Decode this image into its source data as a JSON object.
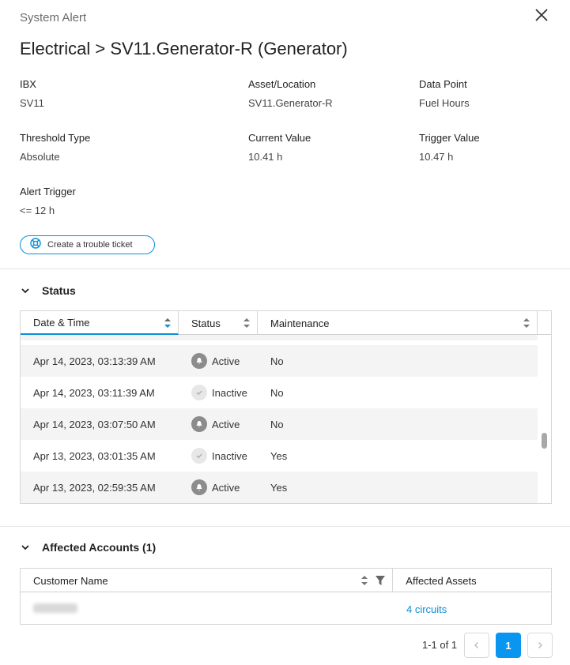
{
  "header": {
    "kicker": "System Alert",
    "title": "Electrical > SV11.Generator-R (Generator)"
  },
  "details": [
    {
      "label": "IBX",
      "value": "SV11"
    },
    {
      "label": "Asset/Location",
      "value": "SV11.Generator-R"
    },
    {
      "label": "Data Point",
      "value": "Fuel Hours"
    },
    {
      "label": "Threshold Type",
      "value": "Absolute"
    },
    {
      "label": "Current Value",
      "value": "10.41 h"
    },
    {
      "label": "Trigger Value",
      "value": "10.47 h"
    },
    {
      "label": "Alert Trigger",
      "value": "<= 12 h"
    }
  ],
  "ticket_button": {
    "label": "Create a trouble ticket"
  },
  "status_section": {
    "title": "Status",
    "columns": [
      "Date & Time",
      "Status",
      "Maintenance"
    ],
    "rows": [
      {
        "date": "Apr 14, 2023, 03:13:39 AM",
        "status": "Active",
        "maintenance": "No"
      },
      {
        "date": "Apr 14, 2023, 03:11:39 AM",
        "status": "Inactive",
        "maintenance": "No"
      },
      {
        "date": "Apr 14, 2023, 03:07:50 AM",
        "status": "Active",
        "maintenance": "No"
      },
      {
        "date": "Apr 13, 2023, 03:01:35 AM",
        "status": "Inactive",
        "maintenance": "Yes"
      },
      {
        "date": "Apr 13, 2023, 02:59:35 AM",
        "status": "Active",
        "maintenance": "Yes"
      }
    ]
  },
  "accounts_section": {
    "title": "Affected Accounts (1)",
    "columns": [
      "Customer Name",
      "Affected Assets"
    ],
    "rows": [
      {
        "assets": "4 circuits"
      }
    ]
  },
  "pagination": {
    "summary": "1-1 of 1",
    "current_page": "1"
  },
  "colors": {
    "accent": "#0a96f0",
    "active_icon": "#8c8c8c",
    "inactive_icon": "#e7e7e7"
  }
}
